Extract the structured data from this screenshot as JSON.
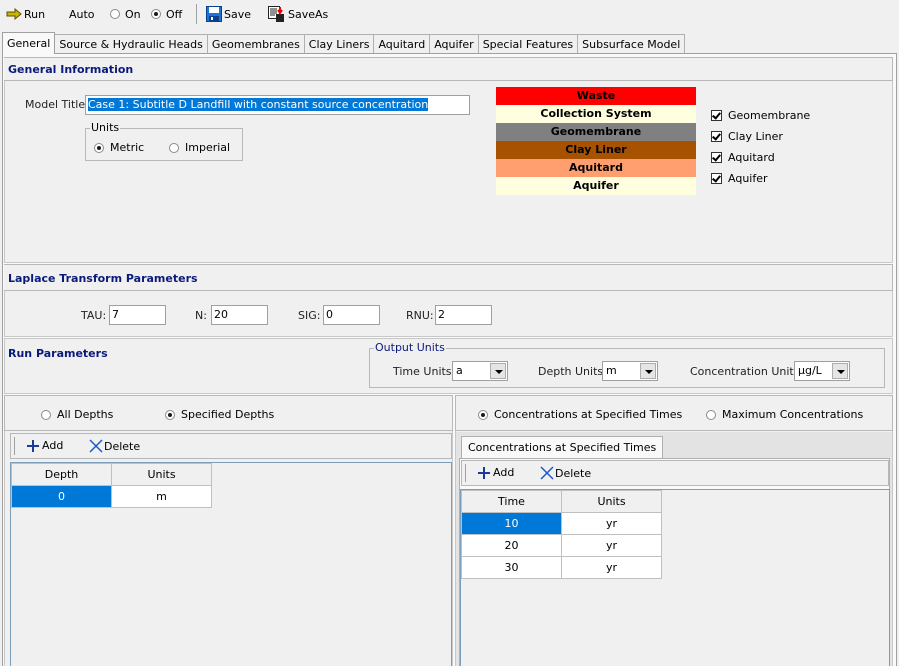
{
  "toolbar": {
    "run_label": "Run",
    "auto_label": "Auto",
    "on_label": "On",
    "off_label": "Off",
    "auto_mode": "Off",
    "save_label": "Save",
    "saveas_label": "SaveAs"
  },
  "tabs": [
    {
      "label": "General",
      "active": true
    },
    {
      "label": "Source & Hydraulic Heads",
      "active": false
    },
    {
      "label": "Geomembranes",
      "active": false
    },
    {
      "label": "Clay Liners",
      "active": false
    },
    {
      "label": "Aquitard",
      "active": false
    },
    {
      "label": "Aquifer",
      "active": false
    },
    {
      "label": "Special Features",
      "active": false
    },
    {
      "label": "Subsurface Model",
      "active": false
    }
  ],
  "general_info": {
    "header": "General Information",
    "model_title_label": "Model Title:",
    "model_title_value": "Case 1: Subtitle D Landfill with constant source concentration",
    "units_group_title": "Units",
    "units_metric": "Metric",
    "units_imperial": "Imperial",
    "units_selected": "Metric",
    "layers": [
      {
        "label": "Waste",
        "color": "#ff0000"
      },
      {
        "label": "Collection System",
        "color": "#ffffe0"
      },
      {
        "label": "Geomembrane",
        "color": "#808080"
      },
      {
        "label": "Clay Liner",
        "color": "#a65200"
      },
      {
        "label": "Aquitard",
        "color": "#ff9e6e"
      },
      {
        "label": "Aquifer",
        "color": "#ffffe0"
      }
    ],
    "checkboxes": [
      {
        "label": "Geomembrane",
        "checked": true
      },
      {
        "label": "Clay Liner",
        "checked": true
      },
      {
        "label": "Aquitard",
        "checked": true
      },
      {
        "label": "Aquifer",
        "checked": true
      }
    ]
  },
  "laplace": {
    "header": "Laplace Transform Parameters",
    "tau_label": "TAU:",
    "tau_value": "7",
    "n_label": "N:",
    "n_value": "20",
    "sig_label": "SIG:",
    "sig_value": "0",
    "rnu_label": "RNU:",
    "rnu_value": "2"
  },
  "run_params": {
    "header": "Run Parameters",
    "output_units_title": "Output Units",
    "time_units_label": "Time Units:",
    "time_units_value": "a",
    "depth_units_label": "Depth Units:",
    "depth_units_value": "m",
    "conc_units_label": "Concentration Units:",
    "conc_units_value": "µg/L"
  },
  "depths": {
    "all_label": "All Depths",
    "specified_label": "Specified Depths",
    "selected": "Specified Depths",
    "add_label": "Add",
    "delete_label": "Delete",
    "columns": [
      "Depth",
      "Units"
    ],
    "rows": [
      [
        "0",
        "m"
      ]
    ]
  },
  "times": {
    "specified_label": "Concentrations at Specified Times",
    "maximum_label": "Maximum Concentrations",
    "selected": "Concentrations at Specified Times",
    "tab_label": "Concentrations at Specified Times",
    "add_label": "Add",
    "delete_label": "Delete",
    "columns": [
      "Time",
      "Units"
    ],
    "rows": [
      [
        "10",
        "yr"
      ],
      [
        "20",
        "yr"
      ],
      [
        "30",
        "yr"
      ]
    ]
  }
}
